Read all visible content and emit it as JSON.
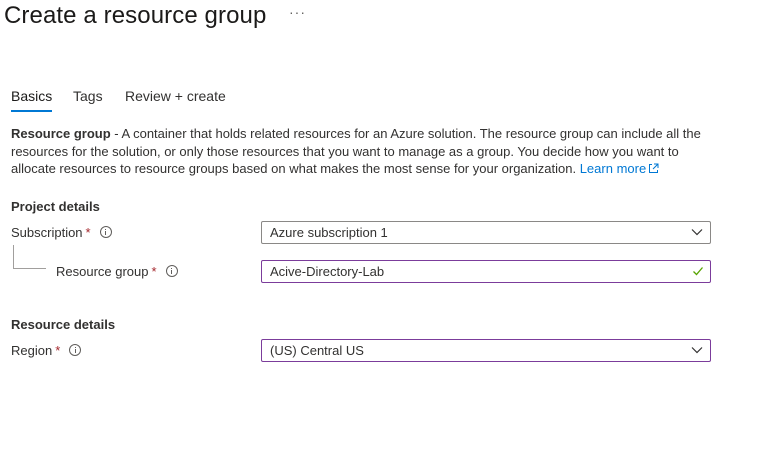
{
  "header": {
    "title": "Create a resource group",
    "more_label": "···"
  },
  "tabs": [
    {
      "label": "Basics",
      "active": true
    },
    {
      "label": "Tags",
      "active": false
    },
    {
      "label": "Review + create",
      "active": false
    }
  ],
  "description": {
    "bold": "Resource group",
    "text": " - A container that holds related resources for an Azure solution. The resource group can include all the resources for the solution, or only those resources that you want to manage as a group. You decide how you want to allocate resources to resource groups based on what makes the most sense for your organization. ",
    "link": "Learn more"
  },
  "project_details": {
    "heading": "Project details",
    "subscription": {
      "label": "Subscription",
      "required_mark": "*",
      "value": "Azure subscription 1"
    },
    "resource_group": {
      "label": "Resource group",
      "required_mark": "*",
      "value": "Acive-Directory-Lab"
    }
  },
  "resource_details": {
    "heading": "Resource details",
    "region": {
      "label": "Region",
      "required_mark": "*",
      "value": "(US) Central US"
    }
  },
  "colors": {
    "accent": "#0078d4",
    "required": "#a4262c",
    "focus_border": "#7b3c9b",
    "valid_check": "#57a300"
  },
  "icons": {
    "info": "info-icon",
    "dropdown": "chevron-down-icon",
    "valid": "checkmark-icon",
    "external": "external-link-icon"
  }
}
